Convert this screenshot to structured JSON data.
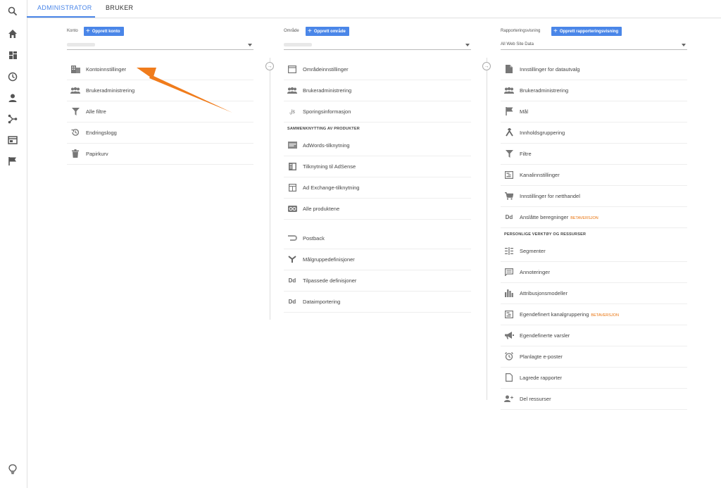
{
  "tabs": [
    {
      "label": "ADMINISTRATOR"
    },
    {
      "label": "BRUKER"
    }
  ],
  "sidebar": {
    "icons": [
      "search-icon",
      "home-icon",
      "dashboard-icon",
      "clock-icon",
      "person-icon",
      "acquisition-icon",
      "behavior-icon",
      "flag-icon",
      "lightbulb-icon"
    ]
  },
  "colors": {
    "accent": "#4a86e8",
    "beta": "#e8710a",
    "arrow": "#f07c1c"
  },
  "account": {
    "label": "Konto",
    "create": "Opprett konto",
    "items": [
      {
        "label": "Kontoinnstillinger",
        "icon": "building-icon"
      },
      {
        "label": "Brukeradministrering",
        "icon": "people-icon"
      },
      {
        "label": "Alle filtre",
        "icon": "filter-icon"
      },
      {
        "label": "Endringslogg",
        "icon": "history-icon"
      },
      {
        "label": "Papirkurv",
        "icon": "trash-icon"
      }
    ]
  },
  "property": {
    "label": "Område",
    "create": "Opprett område",
    "items": [
      {
        "label": "Områdeinnstillinger",
        "icon": "window-icon"
      },
      {
        "label": "Brukeradministrering",
        "icon": "people-icon"
      },
      {
        "label": "Sporingsinformasjon",
        "icon": "js-icon"
      }
    ],
    "section": "SAMMENKNYTTING AV PRODUKTER",
    "products": [
      {
        "label": "AdWords-tilknytning",
        "icon": "adwords-icon"
      },
      {
        "label": "Tilknytning til AdSense",
        "icon": "adsense-icon"
      },
      {
        "label": "Ad Exchange-tilknytning",
        "icon": "adexchange-icon"
      },
      {
        "label": "Alle produktene",
        "icon": "link-icon"
      }
    ],
    "more": [
      {
        "label": "Postback",
        "icon": "postback-icon"
      },
      {
        "label": "Målgruppedefinisjoner",
        "icon": "audience-icon"
      },
      {
        "label": "Tilpassede definisjoner",
        "icon": "dd-icon"
      },
      {
        "label": "Dataimportering",
        "icon": "dd-icon"
      }
    ]
  },
  "view": {
    "label": "Rapporteringsvisning",
    "create": "Opprett rapporteringsvisning",
    "selected": "All Web Site Data",
    "items": [
      {
        "label": "Innstillinger for datautvalg",
        "icon": "document-icon"
      },
      {
        "label": "Brukeradministrering",
        "icon": "people-icon"
      },
      {
        "label": "Mål",
        "icon": "flag-icon"
      },
      {
        "label": "Innholdsgruppering",
        "icon": "grouping-icon"
      },
      {
        "label": "Filtre",
        "icon": "filter-icon"
      },
      {
        "label": "Kanalinnstillinger",
        "icon": "channel-icon"
      },
      {
        "label": "Innstillinger for netthandel",
        "icon": "cart-icon"
      },
      {
        "label": "Anslåtte beregninger",
        "icon": "dd-icon",
        "badge": "BETAVERSJON"
      }
    ],
    "section": "PERSONLIGE VERKTØY OG RESSURSER",
    "personal": [
      {
        "label": "Segmenter",
        "icon": "segments-icon"
      },
      {
        "label": "Annoteringer",
        "icon": "comment-icon"
      },
      {
        "label": "Attribusjonsmodeller",
        "icon": "bars-icon"
      },
      {
        "label": "Egendefinert kanalgruppering",
        "icon": "channel-icon",
        "badge": "BETAVERSJON"
      },
      {
        "label": "Egendefinerte varsler",
        "icon": "megaphone-icon"
      },
      {
        "label": "Planlagte e-poster",
        "icon": "alarm-icon"
      },
      {
        "label": "Lagrede rapporter",
        "icon": "saved-icon"
      },
      {
        "label": "Del ressurser",
        "icon": "share-user-icon"
      }
    ]
  }
}
